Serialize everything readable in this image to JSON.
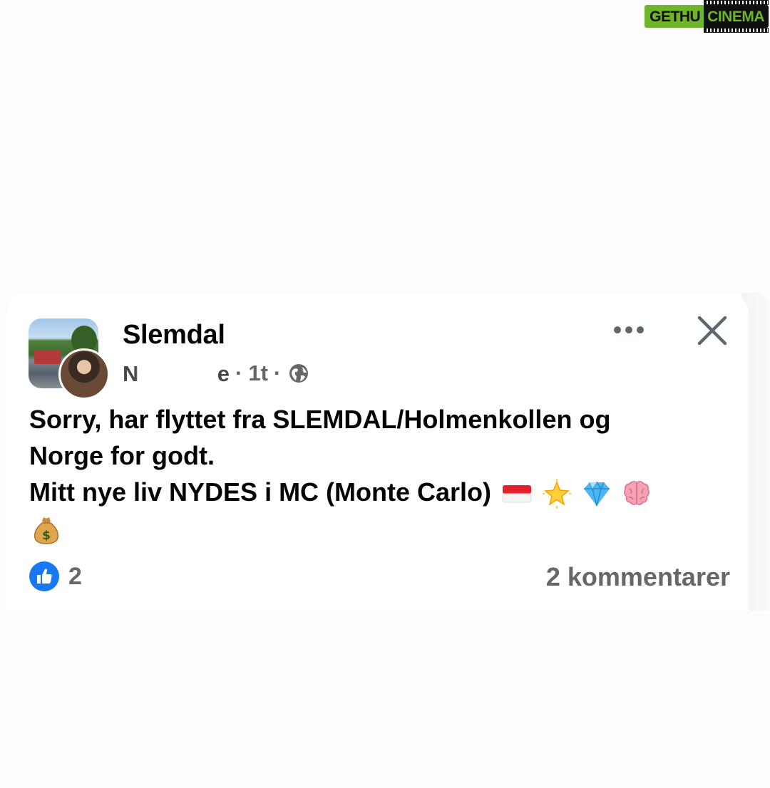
{
  "watermark": {
    "part1": "GETHU",
    "part2": "CINEMA"
  },
  "post": {
    "group_name": "Slemdal",
    "author_fragment_start": "N",
    "author_fragment_end": "e",
    "separator": "·",
    "time": "1t",
    "lines": [
      "Sorry, har flyttet fra SLEMDAL/Holmenkollen og",
      "Norge for godt.",
      "Mitt nye liv NYDES i MC (Monte Carlo)"
    ],
    "emojis": [
      "monaco-flag",
      "glowing-star",
      "gem",
      "brain",
      "money-bag"
    ],
    "reaction_count": "2",
    "comments_label": "2 kommentarer"
  },
  "colors": {
    "like_blue": "#1877f2",
    "secondary_text": "#65676b",
    "primary_text": "#050505"
  }
}
